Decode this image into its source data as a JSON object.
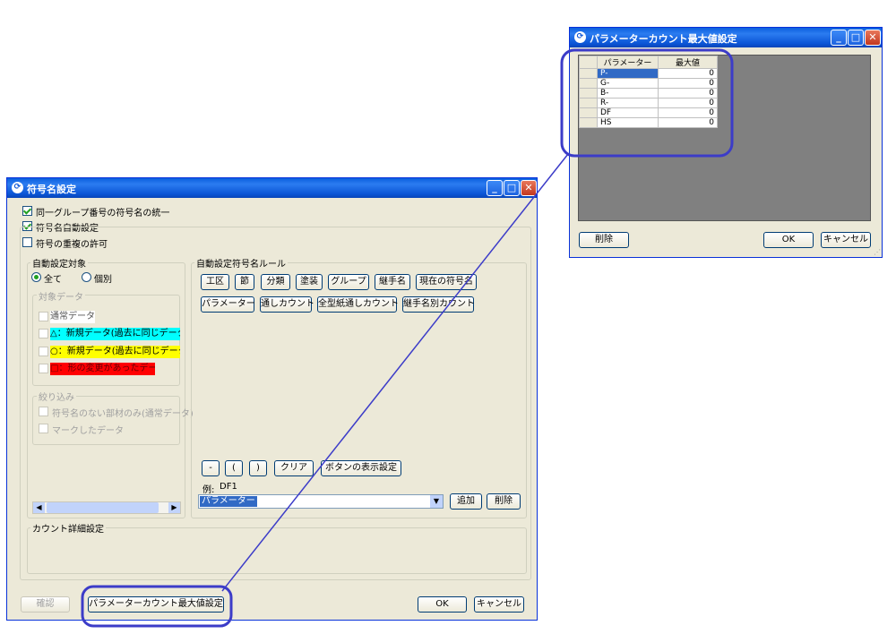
{
  "main_dialog": {
    "title": "符号名設定",
    "checkboxes": [
      {
        "label": "同一グループ番号の符号名の統一",
        "checked": true
      },
      {
        "label": "符号名自動設定",
        "checked": true
      },
      {
        "label": "符号の重複の許可",
        "checked": false
      }
    ],
    "target_group": {
      "label": "自動設定対象",
      "radio_all": "全て",
      "radio_individual": "個別",
      "data_group_label": "対象データ",
      "data_items": [
        {
          "label": "通常データ",
          "color": "#ffffff"
        },
        {
          "label": "△：新規データ(過去に同じデータな",
          "color": "#00ffff"
        },
        {
          "label": "○：新規データ(過去に同じデータあ",
          "color": "#ffff00"
        },
        {
          "label": "□：形の変更があったデータ",
          "color": "#ff0000"
        }
      ],
      "filter_label": "絞り込み",
      "filter_items": [
        "符号名のない部材のみ(通常データ)",
        "マークしたデータ"
      ]
    },
    "rule_group": {
      "label": "自動設定符号名ルール",
      "buttons_row1": [
        "工区",
        "節",
        "分類",
        "塗装",
        "グループ",
        "継手名",
        "現在の符号名"
      ],
      "buttons_row2": [
        "パラメーター",
        "通しカウント",
        "全型紙通しカウント",
        "継手名別カウント"
      ],
      "op_buttons": [
        "-",
        "(",
        ")",
        "クリア",
        "ボタンの表示設定"
      ],
      "example_label": "例:",
      "example_value": "DF1",
      "select_value": "パラメーター",
      "add_button": "追加",
      "delete_button": "削除"
    },
    "count_detail_label": "カウント詳細設定",
    "footer": {
      "confirm_button": "確認",
      "param_button": "パラメーターカウント最大値設定",
      "ok_button": "OK",
      "cancel_button": "キャンセル"
    }
  },
  "param_dialog": {
    "title": "パラメーターカウント最大値設定",
    "columns": [
      "パラメーター",
      "最大値"
    ],
    "rows": [
      {
        "name": "P-",
        "value": "0"
      },
      {
        "name": "G-",
        "value": "0"
      },
      {
        "name": "B-",
        "value": "0"
      },
      {
        "name": "R-",
        "value": "0"
      },
      {
        "name": "DF",
        "value": "0"
      },
      {
        "name": "HS",
        "value": "0"
      }
    ],
    "delete_button": "削除",
    "ok_button": "OK",
    "cancel_button": "キャンセル"
  },
  "colors": {
    "highlight": "#3c3cc8",
    "selection": "#316ac5",
    "title_bar": "#0b55d6"
  }
}
